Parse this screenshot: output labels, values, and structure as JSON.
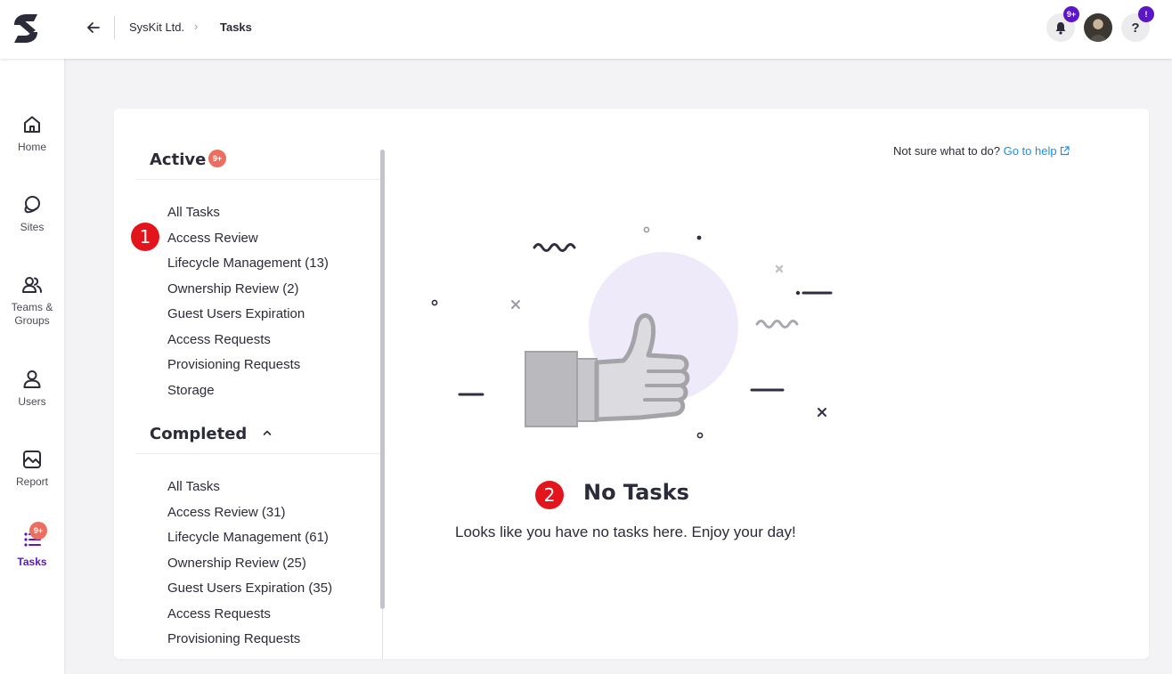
{
  "header": {
    "breadcrumb_org": "SysKit Ltd.",
    "breadcrumb_separator": "›",
    "breadcrumb_current": "Tasks",
    "notifications_badge": "9+",
    "help_badge": "!",
    "help_label": "?"
  },
  "nav": {
    "items": [
      {
        "label": "Home",
        "icon": "home-icon"
      },
      {
        "label": "Sites",
        "icon": "sites-icon"
      },
      {
        "label": "Teams & Groups",
        "icon": "teams-groups-icon"
      },
      {
        "label": "Users",
        "icon": "user-icon"
      },
      {
        "label": "Report",
        "icon": "report-icon"
      },
      {
        "label": "Tasks",
        "icon": "tasks-icon",
        "badge": "9+",
        "active": true
      }
    ]
  },
  "tasks": {
    "active": {
      "title": "Active",
      "badge": "9+",
      "items": [
        "All Tasks",
        "Access Review",
        "Lifecycle Management (13)",
        "Ownership Review (2)",
        "Guest Users Expiration",
        "Access Requests",
        "Provisioning Requests",
        "Storage"
      ]
    },
    "completed": {
      "title": "Completed",
      "items": [
        "All Tasks",
        "Access Review (31)",
        "Lifecycle Management (61)",
        "Ownership Review (25)",
        "Guest Users Expiration (35)",
        "Access Requests",
        "Provisioning Requests"
      ]
    }
  },
  "help": {
    "prompt": "Not sure what to do?",
    "link": "Go to help"
  },
  "empty_state": {
    "title": "No Tasks",
    "description": "Looks like you have no tasks here. Enjoy your day!"
  },
  "markers": {
    "first": "1",
    "second": "2"
  },
  "colors": {
    "accent": "#5b16c6",
    "badge_red": "#ec6e61",
    "link": "#1d8fe0",
    "marker_red": "#e3141c"
  }
}
